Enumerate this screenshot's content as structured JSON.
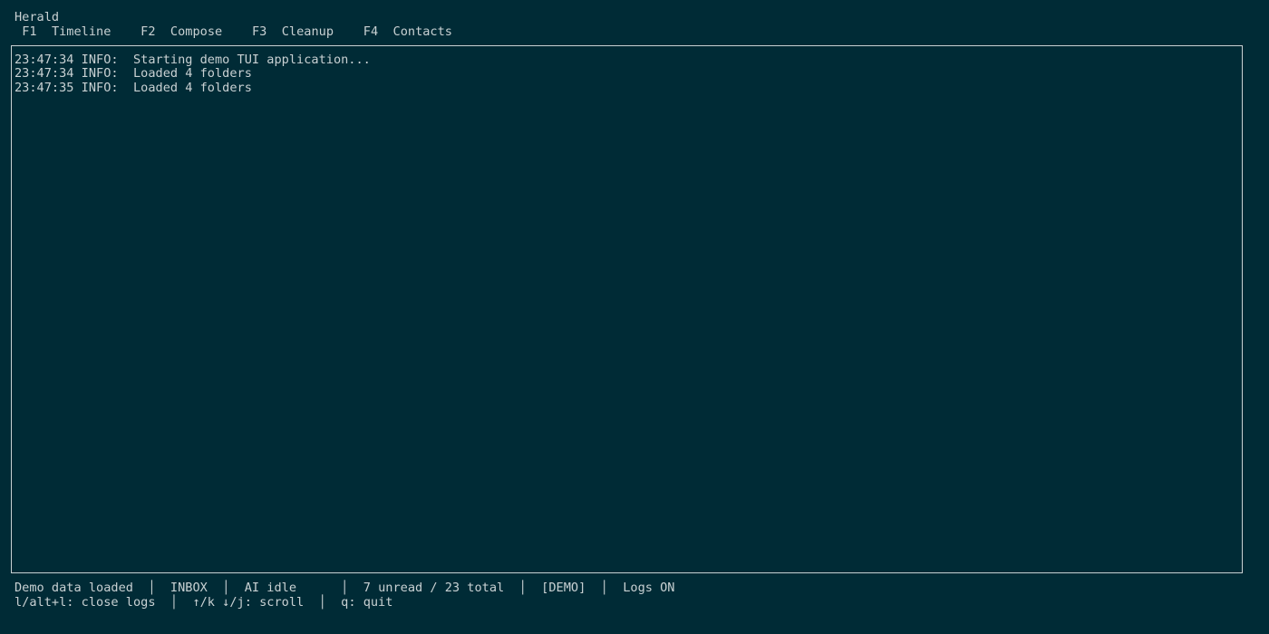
{
  "app": {
    "title": "Herald"
  },
  "tabs": [
    {
      "key": "F1",
      "label": "Timeline"
    },
    {
      "key": "F2",
      "label": "Compose"
    },
    {
      "key": "F3",
      "label": "Cleanup"
    },
    {
      "key": "F4",
      "label": "Contacts"
    }
  ],
  "logs": [
    {
      "time": "23:47:34",
      "level": "INFO:",
      "message": "Starting demo TUI application..."
    },
    {
      "time": "23:47:34",
      "level": "INFO:",
      "message": "Loaded 4 folders"
    },
    {
      "time": "23:47:35",
      "level": "INFO:",
      "message": "Loaded 4 folders"
    }
  ],
  "status": {
    "message": "Demo data loaded",
    "folder": "INBOX",
    "ai": "AI idle",
    "counts": "7 unread / 23 total",
    "mode": "[DEMO]",
    "logs": "Logs ON",
    "separator": "│"
  },
  "help": {
    "close_logs": "l/alt+l: close logs",
    "scroll": "↑/k ↓/j: scroll",
    "quit": "q: quit"
  },
  "colors": {
    "background": "#002b36",
    "foreground": "#c9d1d3"
  }
}
